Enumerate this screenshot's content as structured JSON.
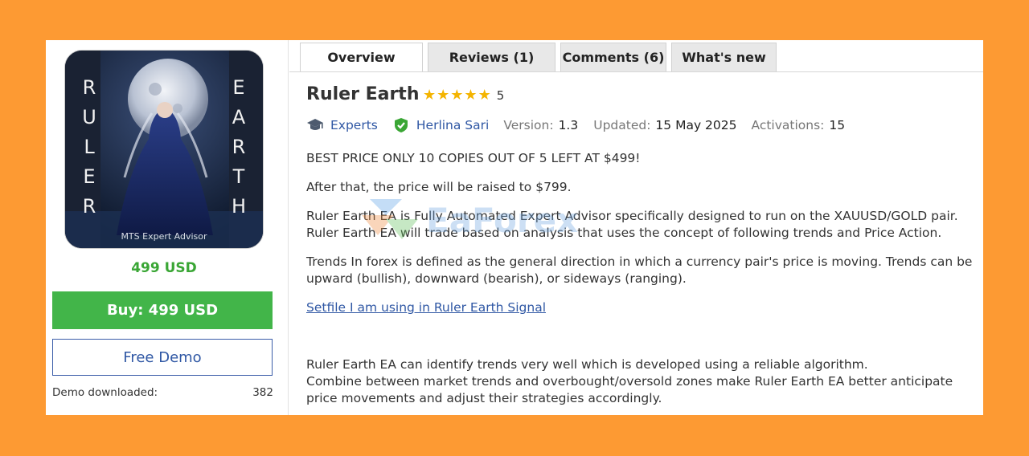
{
  "product": {
    "cover": {
      "left_word": [
        "R",
        "U",
        "L",
        "E",
        "R"
      ],
      "right_word": [
        "E",
        "A",
        "R",
        "T",
        "H"
      ],
      "caption": "MTS Expert Advisor"
    },
    "price": "499 USD",
    "buy_label": "Buy: 499 USD",
    "demo_label": "Free Demo",
    "demo_downloaded_label": "Demo downloaded:",
    "demo_downloaded_value": "382"
  },
  "tabs": [
    {
      "label": "Overview",
      "active": true
    },
    {
      "label": "Reviews (1)",
      "active": false
    },
    {
      "label": "Comments (6)",
      "active": false
    },
    {
      "label": "What's new",
      "active": false
    }
  ],
  "header": {
    "title": "Ruler Earth",
    "rating": "5",
    "rating_stars": 5,
    "category": "Experts",
    "author": "Herlina Sari",
    "version_label": "Version:",
    "version_value": "1.3",
    "updated_label": "Updated:",
    "updated_value": "15 May 2025",
    "activations_label": "Activations:",
    "activations_value": "15"
  },
  "description": {
    "p1": "BEST PRICE ONLY 10 COPIES OUT OF 5 LEFT AT $499!",
    "p2": "After that, the price will be raised to $799.",
    "p3_line1": "Ruler Earth EA is Fully Automated Expert Advisor specifically designed to run on the XAUUSD/GOLD pair.",
    "p3_line2": "Ruler Earth EA will trade based on analysis that uses the concept of following trends and Price Action.",
    "p4_line1": "Trends In forex is defined as the general direction in which a currency pair's price is moving. Trends can be",
    "p4_line2": "upward (bullish), downward (bearish), or sideways (ranging).",
    "link": "Setfile I am using in Ruler Earth Signal",
    "p5_line1": "Ruler Earth EA can identify trends very well which is developed using a reliable algorithm.",
    "p5_line2": "Combine between market trends and overbought/oversold zones make Ruler Earth EA better anticipate",
    "p5_line3": "price movements and adjust their strategies accordingly."
  },
  "watermark": "EaForex",
  "colors": {
    "background": "#fd9a33",
    "buy": "#42b549",
    "price": "#3aa635",
    "link": "#2f57a4",
    "star": "#f4b400"
  }
}
